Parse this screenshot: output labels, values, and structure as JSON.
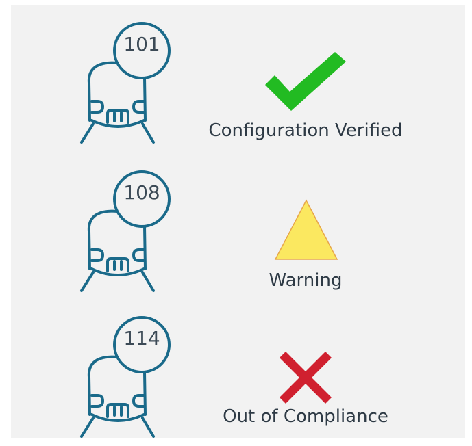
{
  "colors": {
    "panel_bg": "#f2f2f2",
    "train_stroke": "#1a6a8a",
    "verified": "#22bb22",
    "warning_fill": "#fbe860",
    "warning_stroke": "#e7a64a",
    "noncompliant": "#d0202f"
  },
  "rows": [
    {
      "train_number": "101",
      "status_label": "Configuration Verified",
      "status_icon": "check-icon"
    },
    {
      "train_number": "108",
      "status_label": "Warning",
      "status_icon": "warning-triangle-icon"
    },
    {
      "train_number": "114",
      "status_label": "Out of Compliance",
      "status_icon": "x-mark-icon"
    }
  ]
}
